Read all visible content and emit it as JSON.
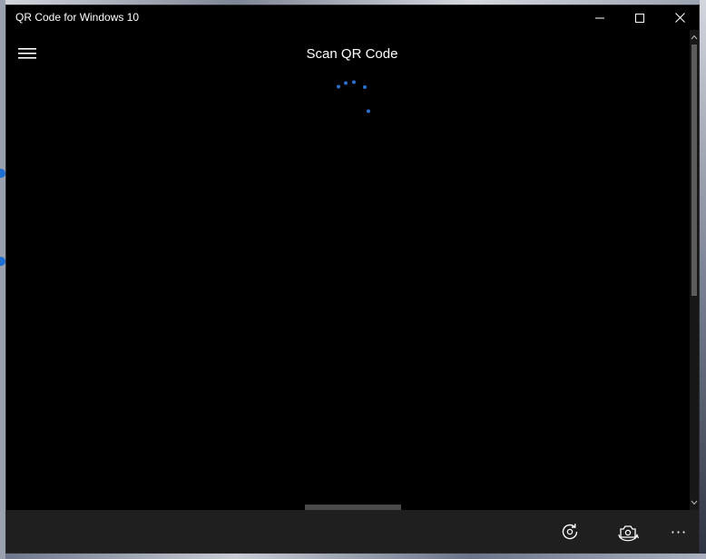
{
  "window": {
    "title": "QR Code for Windows 10"
  },
  "header": {
    "title": "Scan QR Code",
    "menu_icon": "hamburger-icon"
  },
  "window_controls": {
    "minimize_icon": "minimize-icon",
    "maximize_icon": "maximize-icon",
    "close_icon": "close-icon"
  },
  "loading": {
    "indicator": "progress-ring-dots",
    "color": "#2d6fcc"
  },
  "commandbar": {
    "rotate_icon": "rotate-camera-icon",
    "switch_icon": "switch-camera-icon",
    "more_label": "···"
  },
  "colors": {
    "background": "#000000",
    "commandbar": "#1f1f1f",
    "text": "#ffffff",
    "accent": "#2d6fcc"
  }
}
